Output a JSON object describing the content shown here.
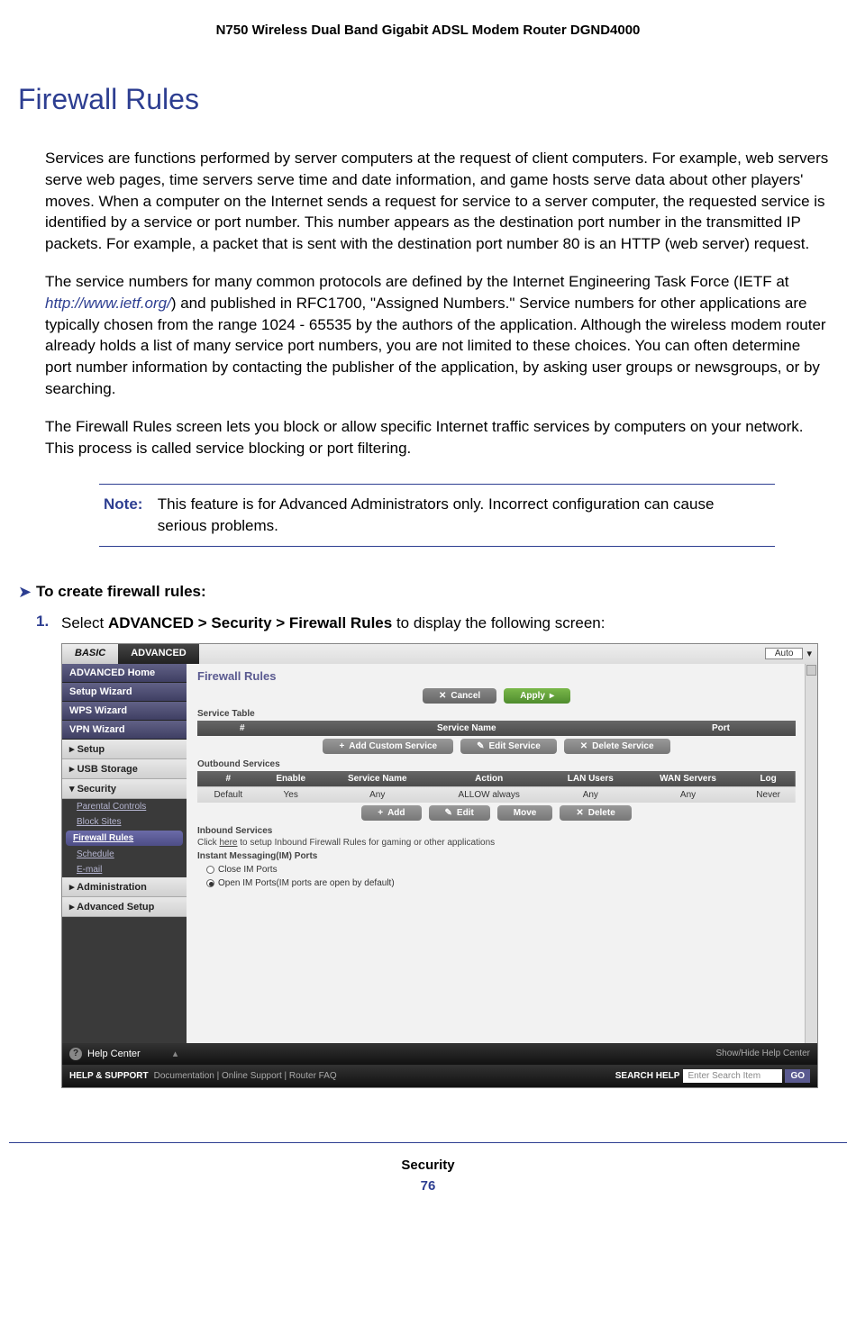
{
  "header": "N750 Wireless Dual Band Gigabit ADSL Modem Router DGND4000",
  "heading": "Firewall Rules",
  "para1": "Services are functions performed by server computers at the request of client computers. For example, web servers serve web pages, time servers serve time and date information, and game hosts serve data about other players' moves. When a computer on the Internet sends a request for service to a server computer, the requested service is identified by a service or port number. This number appears as the destination port number in the transmitted IP packets. For example, a packet that is sent with the destination port number 80 is an HTTP (web server) request.",
  "para2a": "The service numbers for many common protocols are defined by the Internet Engineering Task Force (IETF at ",
  "para2link": "http://www.ietf.org/",
  "para2b": ") and published in RFC1700, \"Assigned Numbers.\" Service numbers for other applications are typically chosen from the range 1024 - 65535 by the authors of the application. Although the wireless modem router already holds a list of many service port numbers, you are not limited to these choices. You can often determine port number information by contacting the publisher of the application, by asking user groups or newsgroups, or by searching.",
  "para3": "The Firewall Rules screen lets you block or allow specific Internet traffic services by computers on your network. This process is called service blocking or port filtering.",
  "note": {
    "label": "Note:",
    "text": "This feature is for Advanced Administrators only. Incorrect configuration can cause serious problems."
  },
  "procedure": {
    "arrow": "➤",
    "title": "To create firewall rules:",
    "step1num": "1.",
    "step1a": "Select ",
    "step1b": "ADVANCED > Security > Firewall Rules",
    "step1c": " to display the following screen:"
  },
  "ss": {
    "tabs": {
      "basic": "BASIC",
      "advanced": "ADVANCED",
      "auto": "Auto"
    },
    "sidebar": {
      "advhome": "ADVANCED Home",
      "setupwiz": "Setup Wizard",
      "wpswiz": "WPS Wizard",
      "vpnwiz": "VPN Wizard",
      "setup": "▸ Setup",
      "usb": "▸ USB Storage",
      "security": "▾ Security",
      "sub": {
        "pc": "Parental Controls",
        "bs": "Block Sites",
        "fr": "Firewall Rules",
        "sch": "Schedule",
        "em": "E-mail"
      },
      "admin": "▸ Administration",
      "advsetup": "▸ Advanced Setup"
    },
    "content": {
      "title": "Firewall Rules",
      "cancel": "Cancel",
      "apply": "Apply",
      "servtable": "Service Table",
      "th_num": "#",
      "th_servname": "Service Name",
      "th_port": "Port",
      "addcustom": "Add Custom Service",
      "editserv": "Edit Service",
      "delserv": "Delete Service",
      "outbound": "Outbound Services",
      "th_enable": "Enable",
      "th_action": "Action",
      "th_lan": "LAN Users",
      "th_wan": "WAN Servers",
      "th_log": "Log",
      "row": {
        "default": "Default",
        "yes": "Yes",
        "any": "Any",
        "allow": "ALLOW always",
        "never": "Never"
      },
      "add": "Add",
      "edit": "Edit",
      "move": "Move",
      "delete": "Delete",
      "inbound_title": "Inbound Services",
      "inbound_text_a": "Click ",
      "inbound_text_link": "here",
      "inbound_text_b": " to setup Inbound Firewall Rules for gaming or other applications",
      "im_title": "Instant Messaging(IM) Ports",
      "im_close": "Close IM Ports",
      "im_open": "Open IM Ports(IM ports are open by default)"
    },
    "help": {
      "label": "Help Center",
      "toggle": "Show/Hide Help Center",
      "support_label": "HELP & SUPPORT",
      "support_links": "Documentation | Online Support | Router FAQ",
      "search_label": "SEARCH HELP",
      "search_placeholder": "Enter Search Item",
      "go": "GO"
    }
  },
  "footer": {
    "section": "Security",
    "page": "76"
  }
}
